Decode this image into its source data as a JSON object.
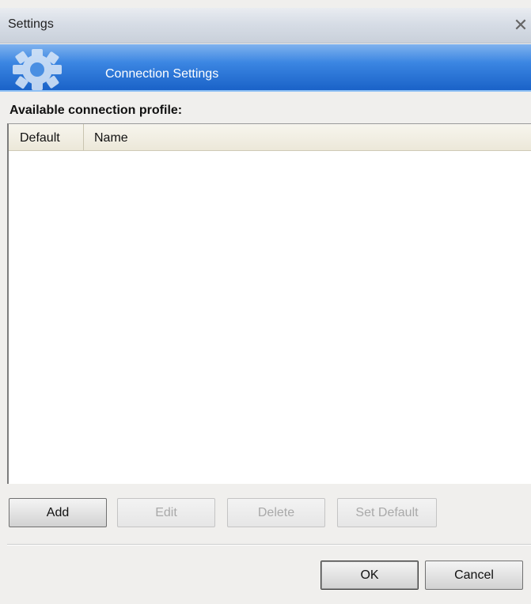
{
  "window": {
    "title": "Settings",
    "close_icon": "close-icon"
  },
  "banner": {
    "title": "Connection Settings",
    "icon": "gear-icon"
  },
  "section": {
    "label": "Available connection profile:"
  },
  "table": {
    "columns": [
      "Default",
      "Name"
    ],
    "rows": []
  },
  "actions": {
    "add": "Add",
    "edit": "Edit",
    "delete": "Delete",
    "set_default": "Set Default"
  },
  "dialog_buttons": {
    "ok": "OK",
    "cancel": "Cancel"
  }
}
